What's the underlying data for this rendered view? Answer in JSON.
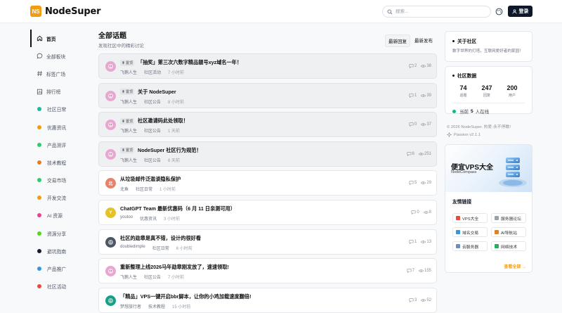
{
  "header": {
    "logo_mark": "NS",
    "logo_text": "NodeSuper",
    "search_placeholder": "搜索...",
    "login_label": "登录"
  },
  "sidebar": {
    "items": [
      {
        "label": "首页",
        "icon": "home-icon",
        "active": true
      },
      {
        "label": "全部板块",
        "icon": "chat-bubble-icon"
      },
      {
        "label": "标签广场",
        "icon": "hash-icon"
      },
      {
        "label": "排行榜",
        "icon": "ranking-icon"
      },
      {
        "label": "社区日常",
        "color": "#1abc9c"
      },
      {
        "label": "优惠资讯",
        "color": "#f39c12"
      },
      {
        "label": "产品测评",
        "color": "#2ecc71"
      },
      {
        "label": "技术教程",
        "color": "#e67e22"
      },
      {
        "label": "交易市场",
        "color": "#2ecc71"
      },
      {
        "label": "开发交流",
        "color": "#f39c12"
      },
      {
        "label": "AI 资源",
        "color": "#e84393"
      },
      {
        "label": "资源分享",
        "color": "#55d61a"
      },
      {
        "label": "避坑指南",
        "color": "#1a1a2e"
      },
      {
        "label": "产品推广",
        "color": "#3498db"
      },
      {
        "label": "社区活动",
        "color": "#e74c3c"
      }
    ]
  },
  "main": {
    "title": "全部话题",
    "subtitle": "发现社区中的精彩讨论",
    "sort": [
      "最新回复",
      "最新发布"
    ],
    "pin_label": "置顶",
    "topics": [
      {
        "title": "「抽奖」第三次六数字精品靓号xyz域名一年！",
        "author": "飞鹅人生",
        "category": "社区活动",
        "time": "7 小时前",
        "comments": "2",
        "views": "38",
        "pinned": true,
        "avatar_color": "#e9a6d0",
        "avatar_text": ""
      },
      {
        "title": "关于 NodeSuper",
        "author": "飞鹅人生",
        "category": "社区公告",
        "time": "8 小时前",
        "comments": "1",
        "views": "39",
        "pinned": true,
        "avatar_color": "#e9a6d0",
        "avatar_text": ""
      },
      {
        "title": "社区邀请码此处领取！",
        "author": "飞鹅人生",
        "category": "社区公告",
        "time": "1 天前",
        "comments": "0",
        "views": "37",
        "pinned": true,
        "avatar_color": "#e9a6d0",
        "avatar_text": ""
      },
      {
        "title": "NodeSuper 社区行为规范！",
        "author": "飞鹅人生",
        "category": "社区公告",
        "time": "6 天前",
        "comments": "6",
        "views": "251",
        "pinned": true,
        "avatar_color": "#e9a6d0",
        "avatar_text": ""
      },
      {
        "title": "从垃圾邮件泛滥谈隐私保护",
        "author": "北鱼",
        "category": "社区日常",
        "time": "1 小时前",
        "comments": "5",
        "views": "29",
        "pinned": false,
        "avatar_color": "#e8826b",
        "avatar_text": "北"
      },
      {
        "title": "ChatGPT Team 最新优惠码（6 月 11 日亲测可用）",
        "author": "youtoo",
        "category": "优惠资讯",
        "time": "3 小时前",
        "comments": "0",
        "views": "8",
        "pinned": false,
        "avatar_color": "#e6c229",
        "avatar_text": "Y"
      },
      {
        "title": "社区的勋章是真不错，设计的很好看",
        "author": "doubledimple",
        "category": "社区日常",
        "time": "6 小时前",
        "comments": "1",
        "views": "13",
        "pinned": false,
        "avatar_color": "#4b5563",
        "avatar_text": ""
      },
      {
        "title": "重新整理上线2026马年勋章刚发放了，速速领取!",
        "author": "飞鹅人生",
        "category": "社区公告",
        "time": "7 小时前",
        "comments": "7",
        "views": "155",
        "pinned": false,
        "avatar_color": "#e9a6d0",
        "avatar_text": ""
      },
      {
        "title": "「精品」VPS一键开启bbr脚本，让你的小鸡加载速度翻倍!",
        "author": "梦想旅行者",
        "category": "技术教程",
        "time": "15 小时前",
        "comments": "3",
        "views": "52",
        "pinned": false,
        "avatar_color": "#16a085",
        "avatar_text": ""
      }
    ]
  },
  "right": {
    "about_title": "关于社区",
    "about_text": "数字世界的灯塔，互联网爱好者的家园！",
    "stats_title": "社区数据",
    "stats": [
      {
        "num": "74",
        "label": "话题"
      },
      {
        "num": "247",
        "label": "回复"
      },
      {
        "num": "200",
        "label": "用户"
      }
    ],
    "online_prefix": "当前",
    "online_num": "5",
    "online_suffix": "人在线",
    "copyright": "© 2026 NodeSuper. 热爱·永不停歇!",
    "version": "Passion v2.1.1",
    "ad_title": "便宜VPS大全",
    "ad_sub": "NodeCompass",
    "links_title": "友情链接",
    "links": [
      {
        "label": "VPS大全",
        "color": "#e74c3c"
      },
      {
        "label": "服务器论坛",
        "color": "#9aa1a9"
      },
      {
        "label": "域名交易",
        "color": "#3498db"
      },
      {
        "label": "AI导航站",
        "color": "#e67e22"
      },
      {
        "label": "云服务器",
        "color": "#6c8ebf"
      },
      {
        "label": "网络技术",
        "color": "#27ae60"
      }
    ],
    "view_all": "查看全部 →"
  }
}
